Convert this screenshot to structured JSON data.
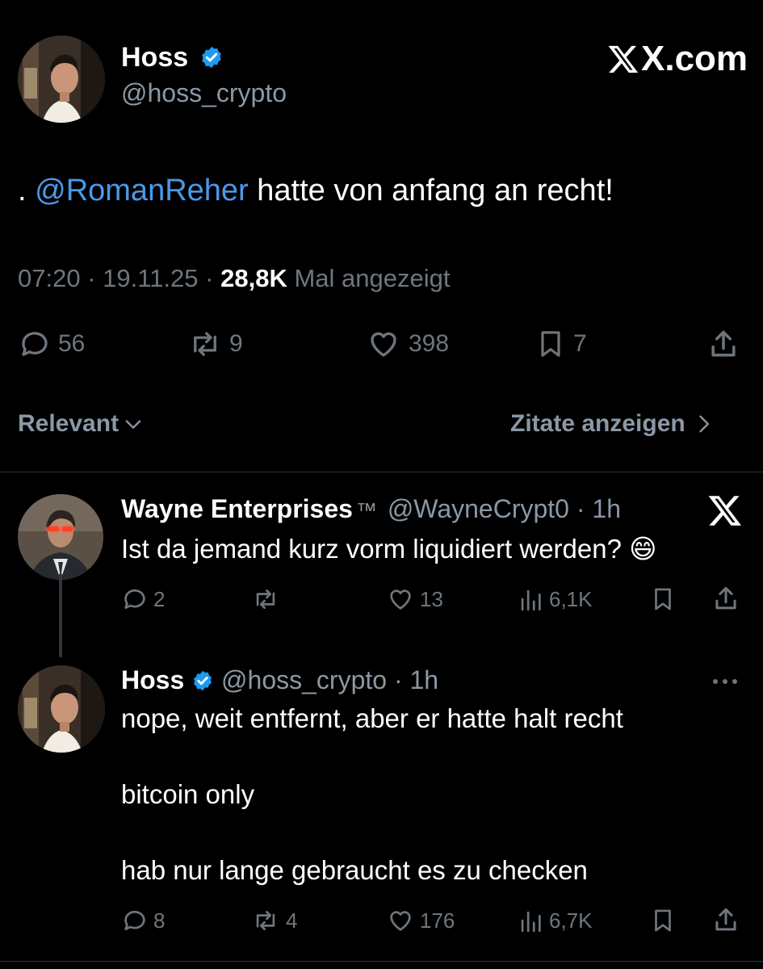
{
  "brand": {
    "watermark": "X.com"
  },
  "main_tweet": {
    "author_name": "Hoss",
    "author_handle": "@hoss_crypto",
    "text_prefix": ". ",
    "mention": "@RomanReher",
    "text_rest": " hatte von anfang an recht!",
    "time": "07:20",
    "separator": "·",
    "date": "19.11.25",
    "views_count": "28,8K",
    "views_label": "Mal angezeigt",
    "replies": "56",
    "reposts": "9",
    "likes": "398",
    "bookmarks": "7"
  },
  "sort_bar": {
    "sort_label": "Relevant",
    "quotes_label": "Zitate anzeigen"
  },
  "replies": [
    {
      "author_name": "Wayne Enterprises",
      "author_suffix": "™",
      "author_handle": "@WayneCrypt0",
      "time_ago": "1h",
      "text": "Ist da jemand kurz vorm liquidiert werden? 😄",
      "replies": "2",
      "reposts": "",
      "likes": "13",
      "views": "6,1K"
    },
    {
      "author_name": "Hoss",
      "author_handle": "@hoss_crypto",
      "time_ago": "1h",
      "text_lines": [
        "nope, weit entfernt, aber er hatte halt recht",
        "bitcoin only",
        "hab nur lange gebraucht es zu checken"
      ],
      "replies": "8",
      "reposts": "4",
      "likes": "176",
      "views": "6,7K"
    }
  ],
  "colors": {
    "background": "#000000",
    "accent_blue": "#1d9bf0",
    "mention_blue": "#4a99e9",
    "muted_gray": "#6e767d",
    "divider": "#2f3336"
  },
  "icons": {
    "verified": "verified-badge-icon",
    "reply": "speech-bubble-icon",
    "repost": "repost-arrows-icon",
    "like": "heart-icon",
    "bookmark": "bookmark-icon",
    "share": "share-upload-icon",
    "views": "bar-chart-icon",
    "more": "more-dots-icon",
    "x_logo": "x-logo-icon"
  }
}
